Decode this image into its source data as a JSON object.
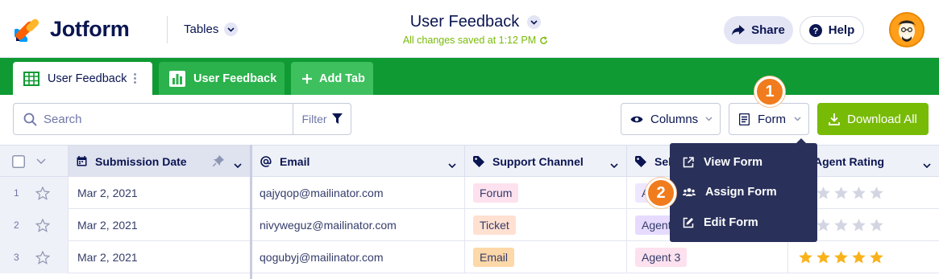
{
  "app": {
    "brand": "Jotform",
    "tables_label": "Tables",
    "title": "User Feedback",
    "saved_status": "All changes saved at 1:12 PM",
    "share_label": "Share",
    "help_label": "Help"
  },
  "tabs": [
    {
      "label": "User Feedback",
      "type": "table",
      "active": true
    },
    {
      "label": "User Feedback",
      "type": "report",
      "active": false
    },
    {
      "label": "Add Tab",
      "type": "add",
      "active": false
    }
  ],
  "toolbar": {
    "search_placeholder": "Search",
    "filter_label": "Filter",
    "columns_label": "Columns",
    "form_label": "Form",
    "download_label": "Download All"
  },
  "columns": [
    "Submission Date",
    "Email",
    "Support Channel",
    "Sele",
    "Agent Rating"
  ],
  "rows": [
    {
      "num": "1",
      "date": "Mar 2, 2021",
      "email": "qajyqop@mailinator.com",
      "channel": "Forum",
      "agent": "A",
      "rating": 0
    },
    {
      "num": "2",
      "date": "Mar 2, 2021",
      "email": "nivyweguz@mailinator.com",
      "channel": "Ticket",
      "agent": "Agent",
      "rating": 1
    },
    {
      "num": "3",
      "date": "Mar 2, 2021",
      "email": "qogubyj@mailinator.com",
      "channel": "Email",
      "agent": "Agent 3",
      "rating": 5
    }
  ],
  "form_menu": [
    {
      "label": "View Form",
      "icon": "external-link-icon"
    },
    {
      "label": "Assign Form",
      "icon": "users-icon"
    },
    {
      "label": "Edit Form",
      "icon": "edit-icon"
    }
  ],
  "badges": [
    "1",
    "2"
  ],
  "colors": {
    "green_strip": "#0f9a33",
    "download_green": "#78bb07",
    "menu_bg": "#29305a",
    "badge_orange": "#f07c1d",
    "star_gold": "#f9b21a"
  }
}
